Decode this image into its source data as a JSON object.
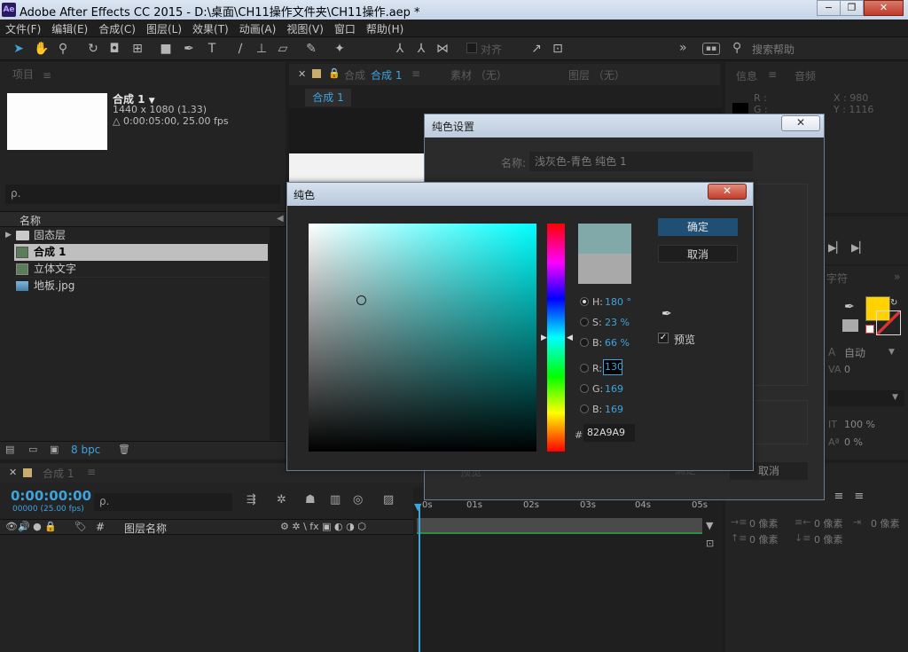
{
  "window": {
    "title": "Adobe After Effects CC 2015 - D:\\桌面\\CH11操作文件夹\\CH11操作.aep *",
    "app_icon": "Ae",
    "controls": {
      "minimize": "−",
      "restore": "❐",
      "close": "✕"
    }
  },
  "menu": [
    "文件(F)",
    "编辑(E)",
    "合成(C)",
    "图层(L)",
    "效果(T)",
    "动画(A)",
    "视图(V)",
    "窗口",
    "帮助(H)"
  ],
  "toolbar": {
    "snap_label": "对齐",
    "search_placeholder": "搜索帮助",
    "overflow": "»"
  },
  "project_panel": {
    "title": "项目",
    "menu_glyph": "≡",
    "comp_name": "合成 1",
    "comp_size": "1440 x 1080 (1.33)",
    "comp_duration": "△ 0:00:05:00, 25.00 fps",
    "search_placeholder": "ρ.",
    "column_name": "名称",
    "items": [
      {
        "name": "固态层",
        "type": "folder"
      },
      {
        "name": "合成 1",
        "type": "comp",
        "selected": true
      },
      {
        "name": "立体文字",
        "type": "comp"
      },
      {
        "name": "地板.jpg",
        "type": "image"
      }
    ],
    "bpc": "8 bpc"
  },
  "comp_panel": {
    "tab_prefix": "合成",
    "tab_name": "合成 1",
    "tab_footage": "素材 （无）",
    "tab_layer": "图层 （无）",
    "breadcrumb": "合成 1"
  },
  "info_panel": {
    "tab_info": "信息",
    "tab_audio": "音频",
    "r_label": "R :",
    "g_label": "G :",
    "x_readout": "X : 980",
    "y_readout": "Y : 1116"
  },
  "character_panel": {
    "tab": "字符",
    "auto_label": "自动",
    "tracking": "0",
    "scale_v": "100 %",
    "baseline": "0 %",
    "fill_color": "#ffd200"
  },
  "paragraph_panel": {
    "indent_left": "0 像素",
    "indent_right": "0 像素",
    "indent_first": "0 像素",
    "space_before": "0 像素",
    "space_after": "0 像素"
  },
  "timeline": {
    "tab_name": "合成 1",
    "timecode": "0:00:00:00",
    "frame_info": "00000 (25.00 fps)",
    "search_placeholder": "ρ.",
    "col_hash": "#",
    "col_layer_name": "图层名称",
    "ruler_labels": [
      "0s",
      "01s",
      "02s",
      "03s",
      "04s",
      "05s"
    ]
  },
  "solid_dialog": {
    "title": "纯色设置",
    "name_label": "名称:",
    "name_value": "浅灰色-青色 纯色 1",
    "preview_label": "预览",
    "ok_label": "确定",
    "cancel_label": "取消"
  },
  "color_picker": {
    "title": "纯色",
    "ok_label": "确定",
    "cancel_label": "取消",
    "preview_label": "预览",
    "h_label": "H:",
    "h_value": "180 °",
    "s_label": "S:",
    "s_value": "23 %",
    "b_label": "B:",
    "b_value": "66 %",
    "r_label": "R:",
    "r_value": "130",
    "g_label": "G:",
    "g_value": "169",
    "bl_label": "B:",
    "bl_value": "169",
    "hex_label": "#",
    "hex_value": "82A9A9",
    "new_color": "#82a9a9",
    "old_color": "#a9a9a9"
  }
}
